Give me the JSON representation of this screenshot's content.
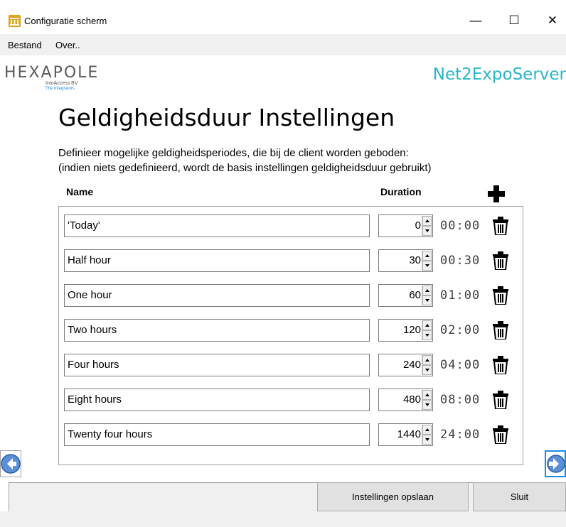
{
  "window": {
    "title": "Configuratie scherm",
    "controls": {
      "minimize": "—",
      "maximize": "☐",
      "close": "✕"
    }
  },
  "menu": [
    "Bestand",
    "Over.."
  ],
  "header": {
    "logo": "HEXAPOLE",
    "logo_sub1": "IntoAccess BV",
    "logo_sub2": "The Integrators",
    "product": "Net2ExpoServer"
  },
  "page": {
    "title": "Geldigheidsduur Instellingen",
    "description_line1": "Definieer mogelijke geldigheidsperiodes, die bij de client worden geboden:",
    "description_line2": "(indien niets gedefinieerd, wordt de basis instellingen geldigheidsduur gebruikt)"
  },
  "table": {
    "headers": {
      "name": "Name",
      "duration": "Duration"
    },
    "rows": [
      {
        "name": "'Today'",
        "duration": "0",
        "time": "00:00"
      },
      {
        "name": "Half hour",
        "duration": "30",
        "time": "00:30"
      },
      {
        "name": "One hour",
        "duration": "60",
        "time": "01:00"
      },
      {
        "name": "Two hours",
        "duration": "120",
        "time": "02:00"
      },
      {
        "name": "Four hours",
        "duration": "240",
        "time": "04:00"
      },
      {
        "name": "Eight hours",
        "duration": "480",
        "time": "08:00"
      },
      {
        "name": "Twenty four hours",
        "duration": "1440",
        "time": "24:00"
      }
    ]
  },
  "footer": {
    "save_label": "Instellingen opslaan",
    "close_label": "Sluit"
  },
  "colors": {
    "accent_blue": "#1e88e5",
    "product_teal": "#29b6c6",
    "app_icon": "#e0a21a"
  }
}
